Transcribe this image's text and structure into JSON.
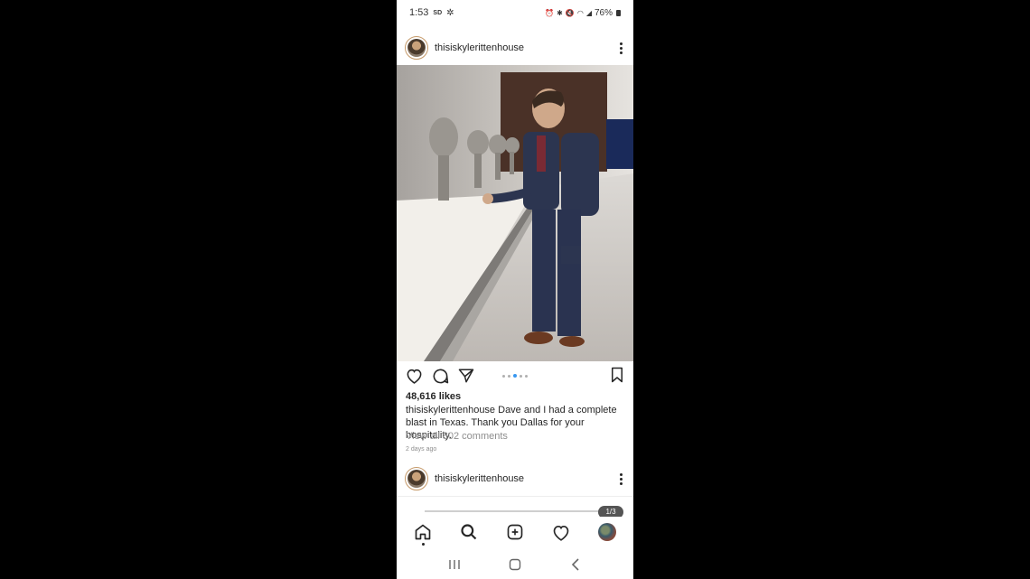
{
  "status_bar": {
    "time": "1:53",
    "sd_badge": "SD",
    "battery": "76%"
  },
  "post1": {
    "username": "thisiskylerittenhouse",
    "likes": "48,616 likes",
    "caption_user": "thisiskylerittenhouse",
    "caption_text": "Dave and I had a complete blast in Texas. Thank you Dallas for your hospitality.",
    "view_comments": "View all 802 comments",
    "time_ago": "2 days ago",
    "carousel_count": 5,
    "carousel_active_index": 2
  },
  "post2": {
    "username": "thisiskylerittenhouse",
    "page_indicator": "1/3"
  },
  "nav": {
    "items": [
      "home-icon",
      "search-icon",
      "add-post-icon",
      "activity-heart-icon",
      "profile-avatar"
    ]
  },
  "system_nav": {
    "items": [
      "recents-icon",
      "home-button-icon",
      "back-icon"
    ]
  },
  "colors": {
    "accent_blue": "#3897f0",
    "text": "#262626",
    "secondary_text": "#8e8e8e"
  }
}
